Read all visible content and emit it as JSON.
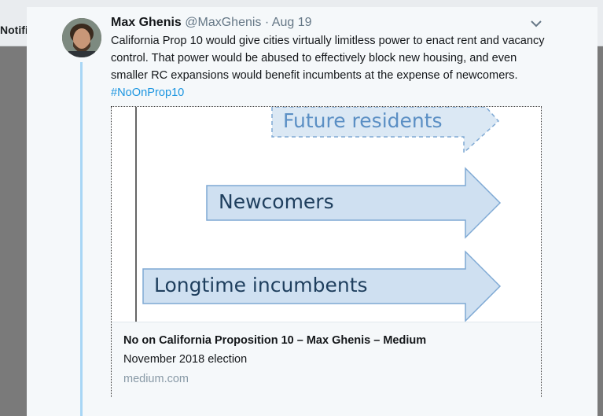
{
  "background": {
    "left_label": "Notifi",
    "right_label": "r"
  },
  "tweet": {
    "display_name": "Max Ghenis",
    "handle": "@MaxGhenis",
    "separator": "·",
    "date": "Aug 19",
    "text": "California Prop 10 would give cities virtually limitless power to enact rent and vacancy control. That power would be abused to effectively block new housing, and even smaller RC expansions would benefit incumbents at the expense of newcomers.",
    "hashtag": "#NoOnProp10"
  },
  "card": {
    "image_labels": {
      "future": "Future residents",
      "newcomers": "Newcomers",
      "incumbents": "Longtime incumbents"
    },
    "title": "No on California Proposition 10 – Max Ghenis – Medium",
    "description": "November 2018 election",
    "domain": "medium.com"
  },
  "colors": {
    "hashtag": "#1b95e0",
    "thread_line": "#a8d6f5",
    "arrow_fill": "#cfe0f1",
    "arrow_stroke": "#7fa9d4"
  },
  "icons": {
    "menu": "chevron-down-icon",
    "avatar": "profile-photo"
  }
}
